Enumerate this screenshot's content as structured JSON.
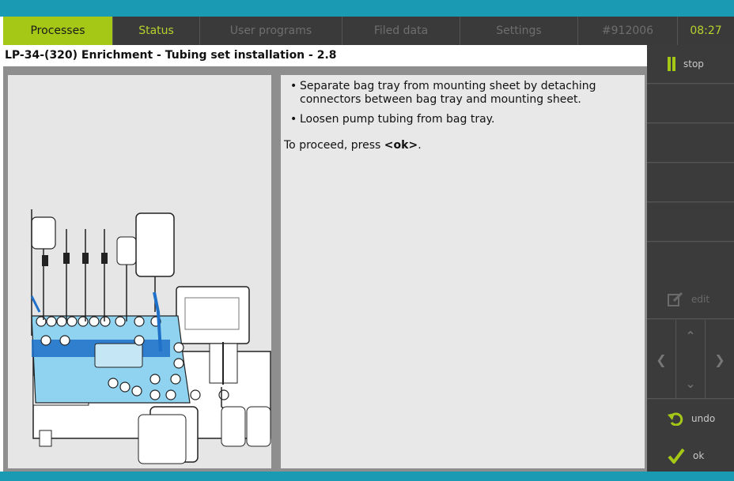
{
  "tabs": [
    {
      "label": "Processes"
    },
    {
      "label": "Status"
    },
    {
      "label": "User programs"
    },
    {
      "label": "Filed data"
    },
    {
      "label": "Settings"
    },
    {
      "label": "#912006"
    },
    {
      "label": "08:27"
    }
  ],
  "title": "LP-34-(320) Enrichment - Tubing set installation - 2.8",
  "instructions": [
    "Separate bag tray from mounting sheet by detaching connectors between bag tray and mounting sheet.",
    "Loosen pump tubing from bag tray."
  ],
  "proceed": {
    "prefix": "To proceed, press ",
    "key": "<ok>",
    "suffix": "."
  },
  "sidebar": {
    "stop_label": "stop",
    "edit_label": "edit",
    "undo_label": "undo",
    "ok_label": "ok"
  },
  "colors": {
    "accent_teal": "#1a9bb3",
    "active_green": "#a5c816",
    "highlight_blue": "#1e88e5"
  },
  "icons": [
    "pause-icon",
    "edit-icon",
    "arrow-left-icon",
    "arrow-up-icon",
    "arrow-down-icon",
    "arrow-right-icon",
    "undo-icon",
    "checkmark-icon"
  ]
}
